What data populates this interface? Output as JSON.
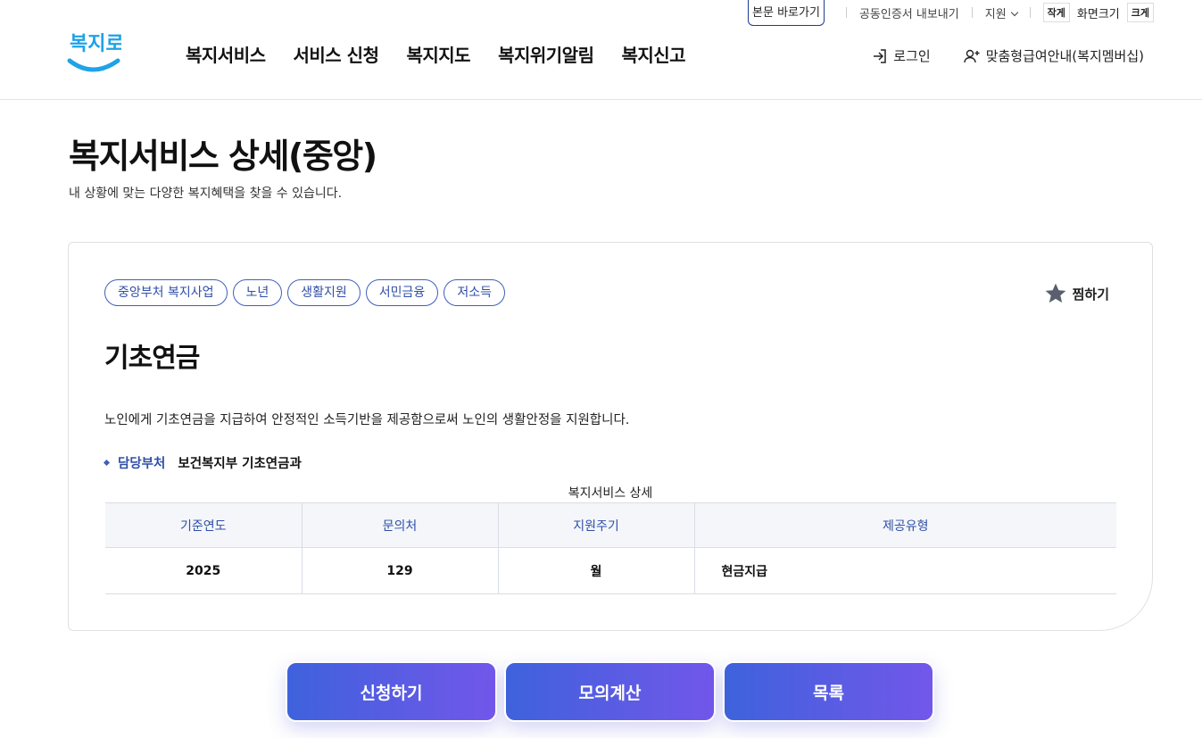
{
  "utility": {
    "skip_link": "본문 바로가기",
    "cert_export": "공동인증서 내보내기",
    "support": "지원",
    "font_small": "작게",
    "font_label": "화면크기",
    "font_large": "크게"
  },
  "header": {
    "logo_text": "복지로",
    "nav": [
      "복지서비스",
      "서비스 신청",
      "복지지도",
      "복지위기알림",
      "복지신고"
    ],
    "login": "로그인",
    "membership": "맞춤형급여안내(복지멤버십)"
  },
  "page": {
    "title": "복지서비스 상세(중앙)",
    "description": "내 상황에 맞는 다양한 복지혜택을 찾을 수 있습니다."
  },
  "service": {
    "tags": [
      "중앙부처 복지사업",
      "노년",
      "생활지원",
      "서민금융",
      "저소득"
    ],
    "favorite_label": "찜하기",
    "title": "기초연금",
    "description": "노인에게 기초연금을 지급하여 안정적인 소득기반을 제공함으로써 노인의 생활안정을 지원합니다.",
    "dept_label": "담당부처",
    "dept_value": "보건복지부 기초연금과",
    "table": {
      "caption": "복지서비스 상세",
      "headers": [
        "기준연도",
        "문의처",
        "지원주기",
        "제공유형"
      ],
      "row": [
        "2025",
        "129",
        "월",
        "현금지급"
      ]
    }
  },
  "actions": {
    "apply": "신청하기",
    "simulate": "모의계산",
    "list": "목록"
  },
  "colors": {
    "accent": "#2f4fa8",
    "button_gradient_start": "#3e62dc",
    "button_gradient_end": "#7257ea",
    "logo_blue": "#1fa2e8"
  }
}
